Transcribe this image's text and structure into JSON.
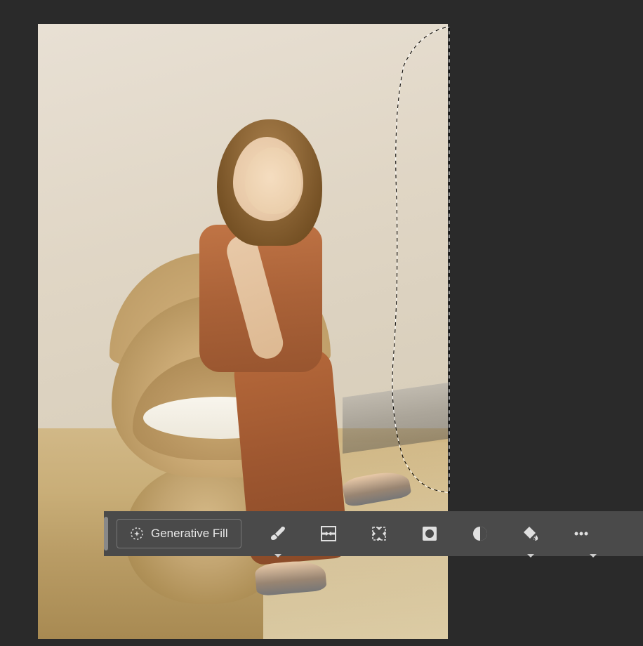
{
  "taskbar": {
    "generative_fill_label": "Generative Fill",
    "tools": [
      {
        "name": "brush-tool",
        "icon": "brush",
        "has_dropdown": true
      },
      {
        "name": "select-subject-tool",
        "icon": "select-subject",
        "has_dropdown": false
      },
      {
        "name": "transform-tool",
        "icon": "transform",
        "has_dropdown": false
      },
      {
        "name": "mask-tool",
        "icon": "mask",
        "has_dropdown": false
      },
      {
        "name": "adjustment-tool",
        "icon": "adjustment",
        "has_dropdown": false
      },
      {
        "name": "fill-tool",
        "icon": "fill",
        "has_dropdown": true
      },
      {
        "name": "more-tool",
        "icon": "more",
        "has_dropdown": true
      }
    ]
  },
  "colors": {
    "background": "#2a2a2a",
    "taskbar_bg": "#4a4a4a",
    "taskbar_border": "#777",
    "text": "#e8e8e8",
    "icon": "#e0e0e0"
  }
}
